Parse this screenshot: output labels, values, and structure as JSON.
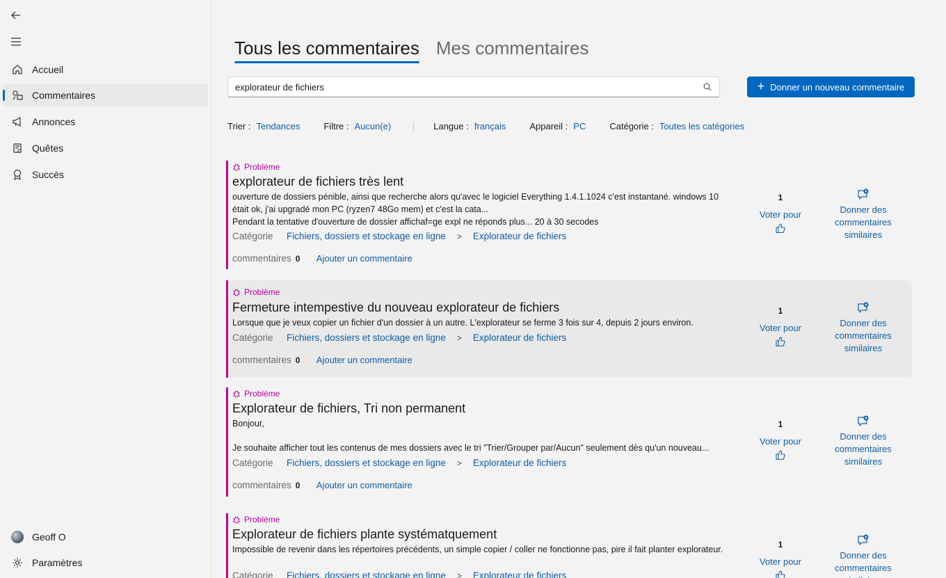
{
  "sidebar": {
    "back_icon": "back-arrow-icon",
    "menu_icon": "hamburger-icon",
    "items": [
      {
        "label": "Accueil",
        "icon": "home-icon"
      },
      {
        "label": "Commentaires",
        "icon": "feedback-icon",
        "active": true
      },
      {
        "label": "Annonces",
        "icon": "megaphone-icon"
      },
      {
        "label": "Quêtes",
        "icon": "quest-icon"
      },
      {
        "label": "Succès",
        "icon": "award-icon"
      }
    ],
    "user": "Geoff O",
    "settings": "Paramètres"
  },
  "tabs": [
    {
      "label": "Tous les commentaires",
      "active": true
    },
    {
      "label": "Mes commentaires",
      "active": false
    }
  ],
  "search": {
    "value": "explorateur de fichiers"
  },
  "new_button": {
    "label": "Donner un nouveau commentaire"
  },
  "filters": {
    "sort_label": "Trier :",
    "sort_value": "Tendances",
    "filter_label": "Filtre :",
    "filter_value": "Aucun(e)",
    "lang_label": "Langue :",
    "lang_value": "français",
    "device_label": "Appareil :",
    "device_value": "PC",
    "cat_label": "Catégorie :",
    "cat_value": "Toutes les catégories"
  },
  "labels": {
    "problem": "Problème",
    "category": "Catégorie",
    "comments": "commentaires",
    "add_comment": "Ajouter un commentaire",
    "vote": "Voter pour",
    "similar": "Donner des commentaires similaires",
    "cat_sep": ">"
  },
  "cards": [
    {
      "title": "explorateur de fichiers très lent",
      "desc": "ouverture de dossiers pénible, ainsi que recherche alors qu'avec le logiciel Everything 1.4.1.1024 c'est instantané. windows 10 était ok, j'ai upgradé mon PC (ryzen7 48Go mem) et c'est la cata...",
      "desc2": "Pendant la tentative d'ouverture de dossier affichaf=ge expl ne réponds plus... 20 à 30 secodes",
      "cat1": "Fichiers, dossiers et stockage en ligne",
      "cat2": "Explorateur de fichiers",
      "comments": "0",
      "votes": "1"
    },
    {
      "title": "Fermeture intempestive du nouveau explorateur de fichiers",
      "desc": "Lorsque que je veux copier un fichier d'un dossier à un autre. L'explorateur se ferme 3 fois sur 4, depuis 2 jours environ.",
      "cat1": "Fichiers, dossiers et stockage en ligne",
      "cat2": "Explorateur de fichiers",
      "comments": "0",
      "votes": "1"
    },
    {
      "title": "Explorateur de fichiers, Tri non permanent",
      "desc": "Bonjour,",
      "desc2": "Je souhaite afficher tout les contenus de mes dossiers avec le tri \"Trier/Grouper par/Aucun\" seulement dès qu'un nouveau...",
      "cat1": "Fichiers, dossiers et stockage en ligne",
      "cat2": "Explorateur de fichiers",
      "comments": "0",
      "votes": "1"
    },
    {
      "title": "Explorateur de fichiers plante systématquement",
      "desc": "Impossible de revenir dans les répertoires précédents, un simple copier / coller ne fonctionne pas, pire il fait planter explorateur.",
      "cat1": "Fichiers, dossiers et stockage en ligne",
      "cat2": "Explorateur de fichiers",
      "votes": "1"
    }
  ]
}
